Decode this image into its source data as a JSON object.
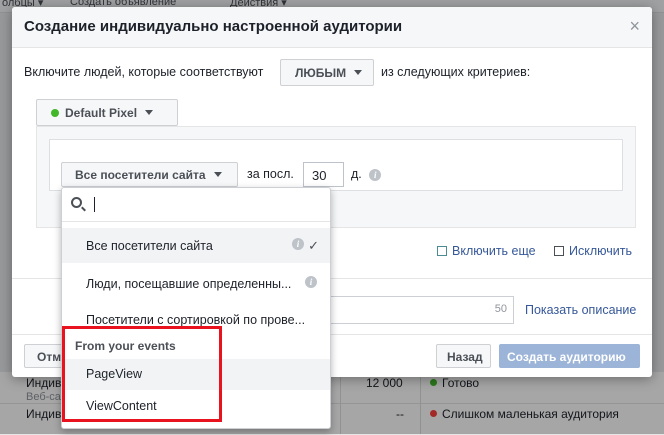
{
  "background": {
    "top_tabs": [
      "олбцы ▾",
      "Создать объявление",
      "Действия ▾"
    ],
    "rows": [
      {
        "name": "Индиви",
        "sub": "Веб-сайт",
        "size": "12 000",
        "status": "Готово",
        "status_color": "#42b72a"
      },
      {
        "name": "Индивидуализированная ауд",
        "sub": "",
        "size": "--",
        "status": "Слишком маленькая аудитория",
        "status_color": "#fa3e3e"
      }
    ]
  },
  "modal": {
    "title": "Создание индивидуально настроенной аудитории",
    "close_glyph": "×",
    "criteria_prefix": "Включите людей, которые соответствуют",
    "match_value": "ЛЮБЫМ",
    "criteria_suffix": "из следующих критериев:",
    "pixel_label": "Default Pixel",
    "rule": {
      "visitors_value": "Все посетители сайта",
      "for_last_label": "за посл.",
      "days_value": "30",
      "days_unit": "д."
    },
    "include_more": "Включить еще",
    "exclude": "Исключить",
    "description_count": "50",
    "show_description": "Показать описание",
    "cancel_label": "Отмена",
    "back_label": "Назад",
    "create_label": "Создать аудиторию"
  },
  "dropdown": {
    "search_value": "",
    "options": [
      {
        "label": "Все посетители сайта",
        "selected": true
      },
      {
        "label": "Люди, посещавшие определенны...",
        "selected": false
      },
      {
        "label": "Посетители с сортировкой по прове...",
        "selected": false
      }
    ],
    "events_header": "From your events",
    "events": [
      "PageView",
      "ViewContent"
    ]
  },
  "colors": {
    "accent": "#365899",
    "highlight": "#e8131f",
    "create_button": "#9cb4d8"
  }
}
